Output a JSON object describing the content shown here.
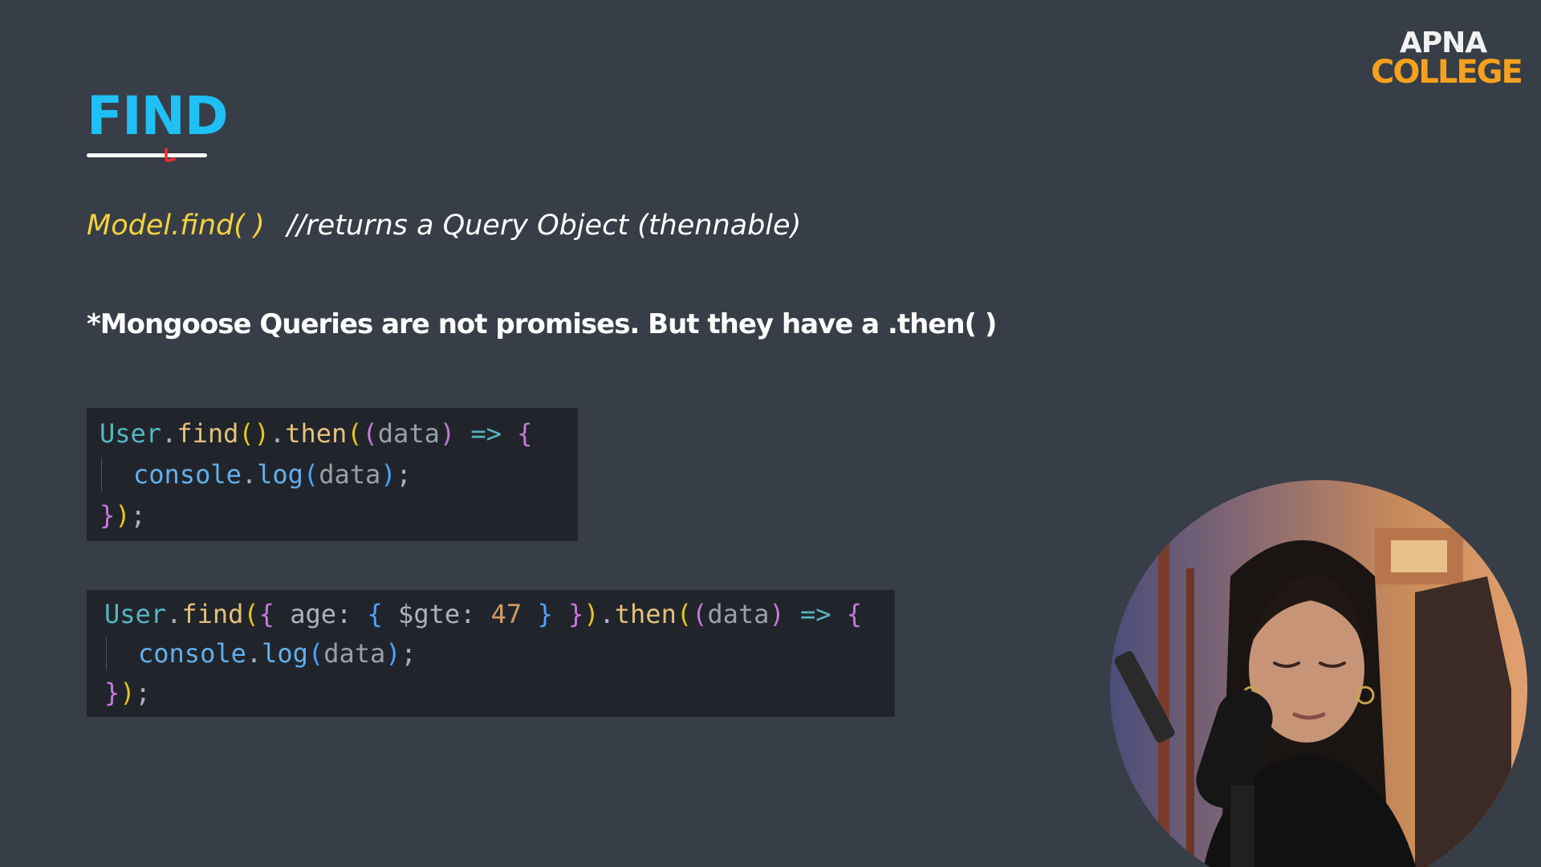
{
  "logo": {
    "line1": "APNA",
    "line2": "COLLEGE",
    "line1_color": "#f2f2f2",
    "line2_color": "#f6a11d"
  },
  "slide": {
    "title": "FIND",
    "title_color": "#1fc0f5",
    "method": {
      "code": "Model.find( )",
      "comment": "//returns a Query Object (thennable)",
      "code_color": "#f3d33c",
      "comment_color": "#ffffff"
    },
    "note": "*Mongoose Queries are not promises. But they have a .then( )",
    "note_color": "#ffffff"
  },
  "colors": {
    "background": "#383e47",
    "code_background": "#21252b",
    "token_object": "#56b6c2",
    "token_function": "#e5c07b",
    "token_punct": "#abb2bf",
    "token_paren": "#e6c619",
    "token_param": "#9aa0a8",
    "token_arrow": "#56b6c2",
    "token_brace": "#c678dd",
    "token_key": "#abb2bf",
    "token_number": "#d19a66",
    "token_bracket_blue": "#4da3ff",
    "token_console": "#61afef"
  },
  "code_blocks": [
    {
      "lines": [
        {
          "indent": false,
          "tokens": [
            {
              "text": "User",
              "color": "#56b6c2"
            },
            {
              "text": ".",
              "color": "#abb2bf"
            },
            {
              "text": "find",
              "color": "#e5c07b"
            },
            {
              "text": "()",
              "color": "#e6c619"
            },
            {
              "text": ".",
              "color": "#abb2bf"
            },
            {
              "text": "then",
              "color": "#e5c07b"
            },
            {
              "text": "(",
              "color": "#e6c619"
            },
            {
              "text": "(",
              "color": "#c678dd"
            },
            {
              "text": "data",
              "color": "#9aa0a8"
            },
            {
              "text": ")",
              "color": "#c678dd"
            },
            {
              "text": " ",
              "color": "#abb2bf"
            },
            {
              "text": "=>",
              "color": "#56b6c2"
            },
            {
              "text": " ",
              "color": "#abb2bf"
            },
            {
              "text": "{",
              "color": "#c678dd"
            }
          ]
        },
        {
          "indent": true,
          "tokens": [
            {
              "text": "console",
              "color": "#61afef"
            },
            {
              "text": ".",
              "color": "#abb2bf"
            },
            {
              "text": "log",
              "color": "#61afef"
            },
            {
              "text": "(",
              "color": "#4da3ff"
            },
            {
              "text": "data",
              "color": "#9aa0a8"
            },
            {
              "text": ")",
              "color": "#4da3ff"
            },
            {
              "text": ";",
              "color": "#abb2bf"
            }
          ]
        },
        {
          "indent": false,
          "tokens": [
            {
              "text": "}",
              "color": "#c678dd"
            },
            {
              "text": ")",
              "color": "#e6c619"
            },
            {
              "text": ";",
              "color": "#abb2bf"
            }
          ]
        }
      ]
    },
    {
      "lines": [
        {
          "indent": false,
          "tokens": [
            {
              "text": "User",
              "color": "#56b6c2"
            },
            {
              "text": ".",
              "color": "#abb2bf"
            },
            {
              "text": "find",
              "color": "#e5c07b"
            },
            {
              "text": "(",
              "color": "#e6c619"
            },
            {
              "text": "{",
              "color": "#c678dd"
            },
            {
              "text": " age: ",
              "color": "#abb2bf"
            },
            {
              "text": "{",
              "color": "#4da3ff"
            },
            {
              "text": " $gte: ",
              "color": "#abb2bf"
            },
            {
              "text": "47",
              "color": "#d19a66"
            },
            {
              "text": " ",
              "color": "#abb2bf"
            },
            {
              "text": "}",
              "color": "#4da3ff"
            },
            {
              "text": " ",
              "color": "#abb2bf"
            },
            {
              "text": "}",
              "color": "#c678dd"
            },
            {
              "text": ")",
              "color": "#e6c619"
            },
            {
              "text": ".",
              "color": "#abb2bf"
            },
            {
              "text": "then",
              "color": "#e5c07b"
            },
            {
              "text": "(",
              "color": "#e6c619"
            },
            {
              "text": "(",
              "color": "#c678dd"
            },
            {
              "text": "data",
              "color": "#9aa0a8"
            },
            {
              "text": ")",
              "color": "#c678dd"
            },
            {
              "text": " ",
              "color": "#abb2bf"
            },
            {
              "text": "=>",
              "color": "#56b6c2"
            },
            {
              "text": " ",
              "color": "#abb2bf"
            },
            {
              "text": "{",
              "color": "#c678dd"
            }
          ]
        },
        {
          "indent": true,
          "tokens": [
            {
              "text": "console",
              "color": "#61afef"
            },
            {
              "text": ".",
              "color": "#abb2bf"
            },
            {
              "text": "log",
              "color": "#61afef"
            },
            {
              "text": "(",
              "color": "#4da3ff"
            },
            {
              "text": "data",
              "color": "#9aa0a8"
            },
            {
              "text": ")",
              "color": "#4da3ff"
            },
            {
              "text": ";",
              "color": "#abb2bf"
            }
          ]
        },
        {
          "indent": false,
          "tokens": [
            {
              "text": "}",
              "color": "#c678dd"
            },
            {
              "text": ")",
              "color": "#e6c619"
            },
            {
              "text": ";",
              "color": "#abb2bf"
            }
          ]
        }
      ]
    }
  ]
}
